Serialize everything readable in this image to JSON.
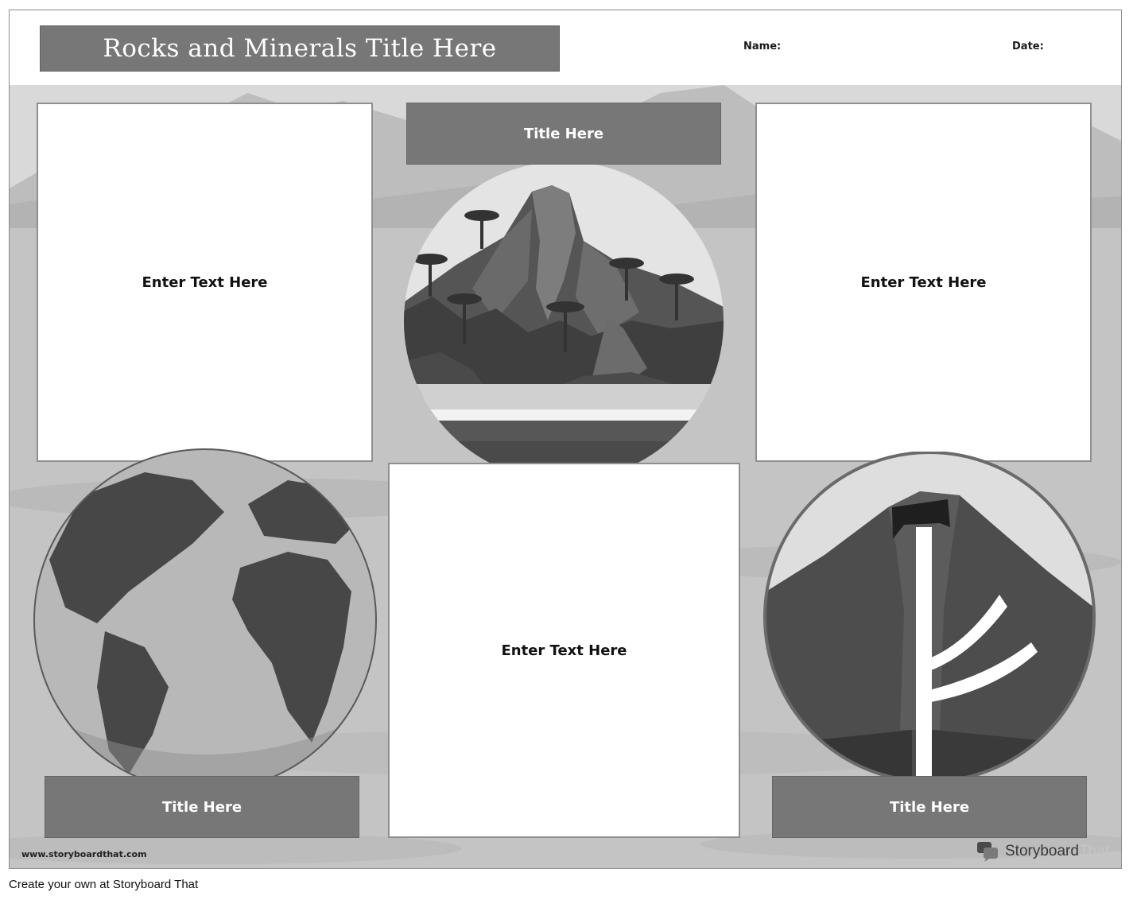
{
  "header": {
    "title": "Rocks and Minerals Title Here",
    "name_label": "Name:",
    "date_label": "Date:"
  },
  "panels": {
    "text_left": "Enter Text Here",
    "text_right": "Enter Text Here",
    "text_center": "Enter Text Here",
    "title_top": "Title Here",
    "title_bottom_left": "Title Here",
    "title_bottom_right": "Title Here"
  },
  "illustrations": {
    "top_center": "volcanic-island-illustration",
    "bottom_left": "earth-globe-illustration",
    "bottom_right": "volcano-cross-section-illustration"
  },
  "branding": {
    "url": "www.storyboardthat.com",
    "brand_dark": "Storyboard",
    "brand_light": "That",
    "icon": "speech-bubble-logo-icon"
  },
  "footer": {
    "text": "Create your own at Storyboard That"
  },
  "colors": {
    "title_fill": "#777777",
    "background_gray": "#c8c8c8",
    "panel_border": "#8f8f8f"
  }
}
